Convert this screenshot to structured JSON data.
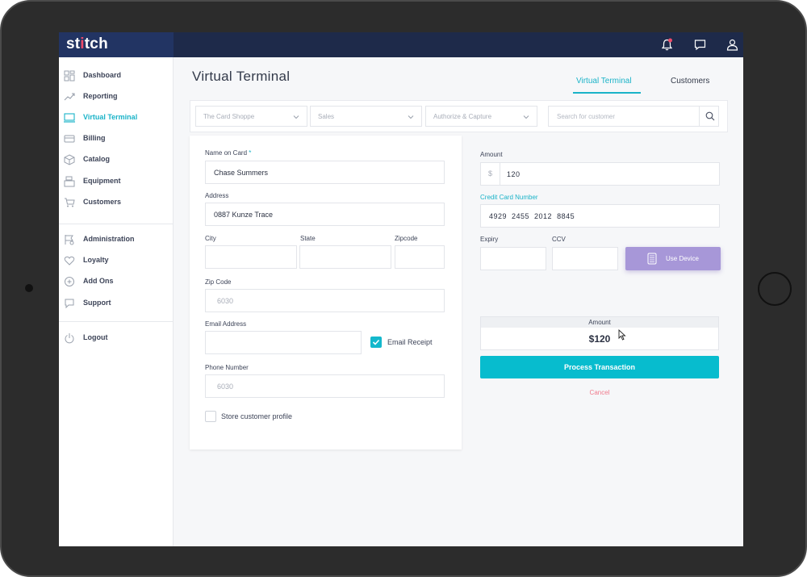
{
  "app": {
    "logo_text": "stitch",
    "logo_dot_char": "i"
  },
  "topbar": {
    "icons": [
      "bell-icon",
      "chat-icon",
      "user-icon"
    ],
    "notification_color": "#ef4b6a"
  },
  "sidebar": {
    "items": [
      {
        "label": "Dashboard",
        "icon": "dashboard-icon"
      },
      {
        "label": "Reporting",
        "icon": "trend-icon"
      },
      {
        "label": "Virtual Terminal",
        "icon": "terminal-icon",
        "active": true
      },
      {
        "label": "Billing",
        "icon": "billing-icon"
      },
      {
        "label": "Catalog",
        "icon": "box-icon"
      },
      {
        "label": "Equipment",
        "icon": "register-icon"
      },
      {
        "label": "Customers",
        "icon": "cart-icon"
      },
      {
        "label": "Administration",
        "icon": "admin-icon"
      },
      {
        "label": "Loyalty",
        "icon": "heart-icon"
      },
      {
        "label": "Add Ons",
        "icon": "plus-circle-icon"
      },
      {
        "label": "Support",
        "icon": "support-icon"
      },
      {
        "label": "Logout",
        "icon": "power-icon"
      }
    ]
  },
  "header": {
    "title": "Virtual Terminal",
    "tabs": [
      {
        "label": "Virtual Terminal",
        "active": true
      },
      {
        "label": "Customers",
        "active": false
      }
    ]
  },
  "filters": {
    "store": "The Card Shoppe",
    "type": "Sales",
    "mode": "Authorize & Capture",
    "search_placeholder": "Search for customer"
  },
  "form": {
    "name_label": "Name on Card",
    "name_required": "*",
    "name_value": "Chase Summers",
    "address_label": "Address",
    "address_value": "0887 Kunze Trace",
    "city_label": "City",
    "state_label": "State",
    "zipcode_label": "Zipcode",
    "zip_code_label": "Zip Code",
    "zip_code_placeholder": "6030",
    "email_label": "Email Address",
    "email_receipt_label": "Email Receipt",
    "email_receipt_checked": true,
    "phone_label": "Phone Number",
    "phone_placeholder": "6030",
    "store_profile_label": "Store customer profile",
    "store_profile_checked": false
  },
  "payment": {
    "amount_label": "Amount",
    "currency_symbol": "$",
    "amount_value": "120",
    "card_label": "Credit Card Number",
    "card_value": "4929  2455  2012  8845",
    "expiry_label": "Expiry",
    "ccv_label": "CCV",
    "use_device_label": "Use Device",
    "summary_label": "Amount",
    "summary_value": "$120",
    "process_label": "Process Transaction",
    "cancel_label": "Cancel"
  },
  "colors": {
    "accent": "#1ab3c8",
    "primary_button": "#07bcce",
    "device_button": "#a797d8",
    "topbar": "#1e2a4a",
    "cancel": "#f07a8c"
  }
}
